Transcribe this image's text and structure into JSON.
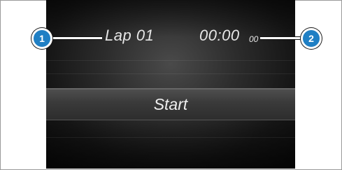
{
  "stopwatch": {
    "lap_label": "Lap 01",
    "time_main": "00:00",
    "time_hundredths": "00",
    "start_label": "Start"
  },
  "callouts": {
    "one": "1",
    "two": "2"
  },
  "colors": {
    "callout_fill": "#1f7fc4",
    "display_bg": "#2c2c2c",
    "text": "#e6e6e6"
  }
}
